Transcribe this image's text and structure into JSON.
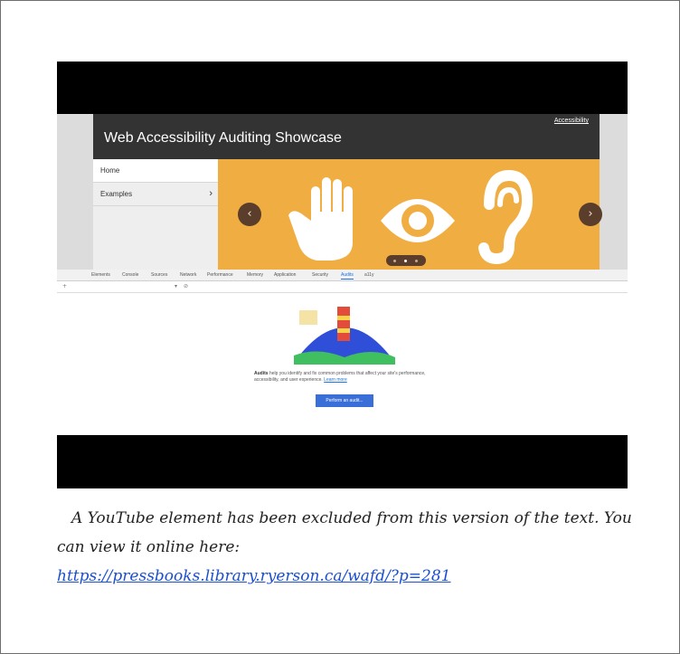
{
  "video": {
    "site_title": "Web Accessibility Auditing Showcase",
    "accessibility_link": "Accessibility",
    "menu": [
      {
        "label": "Home"
      },
      {
        "label": "Examples",
        "chevron": "›"
      }
    ],
    "carousel": {
      "prev": "‹",
      "next": "›",
      "hero_icons": [
        "hand-icon",
        "eye-icon",
        "ear-icon"
      ],
      "hero_color": "#f0ad42"
    },
    "devtools": {
      "tabs": [
        "Elements",
        "Console",
        "Sources",
        "Network",
        "Performance",
        "Memory",
        "Application",
        "Security",
        "Audits",
        "a11y"
      ],
      "active_tab": "Audits",
      "audits_bold": "Audits",
      "audits_text": " help you identify and fix common problems that affect your site's performance, accessibility, and user experience.",
      "learn_more": "Learn more",
      "run_button": "Perform an audit..."
    }
  },
  "caption": {
    "text": "A YouTube element has been excluded from this version of the text. You can view it online here:",
    "link": "https://pressbooks.library.ryerson.ca/wafd/?p=281"
  }
}
